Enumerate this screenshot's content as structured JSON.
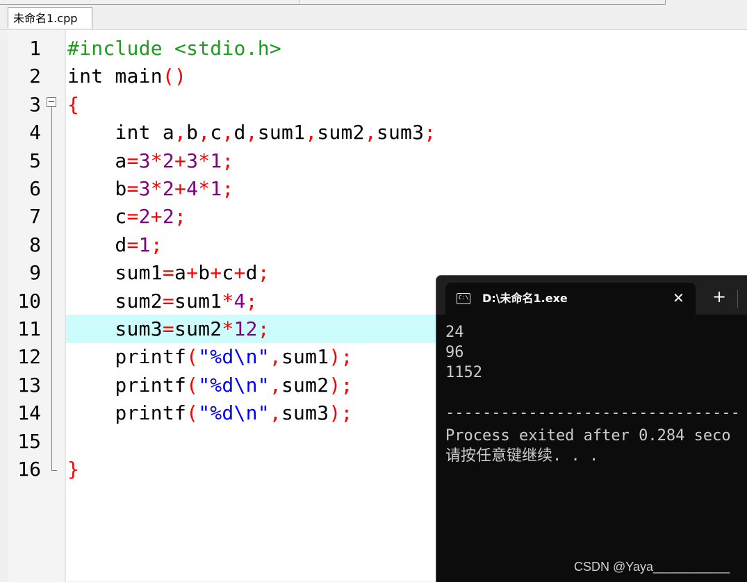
{
  "file_tab": {
    "label": "未命名1.cpp"
  },
  "colors": {
    "preprocessor": "#1f9b1f",
    "operator": "#ff0000",
    "number": "#800080",
    "string": "#0000ff",
    "current_line_highlight": "#ccfcfc",
    "console_background": "#0c0c0c",
    "console_text": "#cccccc"
  },
  "editor": {
    "line_numbers": [
      "1",
      "2",
      "3",
      "4",
      "5",
      "6",
      "7",
      "8",
      "9",
      "10",
      "11",
      "12",
      "13",
      "14",
      "15",
      "16"
    ],
    "highlighted_line": "11",
    "fold_icon": "minus-box-icon",
    "code_lines": [
      [
        {
          "t": "pre",
          "s": "#include <stdio.h>"
        }
      ],
      [
        {
          "t": "kw",
          "s": "int"
        },
        {
          "t": "id",
          "s": " main"
        },
        {
          "t": "op",
          "s": "()"
        }
      ],
      [
        {
          "t": "op",
          "s": "{"
        }
      ],
      [
        {
          "t": "id",
          "s": "    "
        },
        {
          "t": "kw",
          "s": "int"
        },
        {
          "t": "id",
          "s": " a"
        },
        {
          "t": "op",
          "s": ","
        },
        {
          "t": "id",
          "s": "b"
        },
        {
          "t": "op",
          "s": ","
        },
        {
          "t": "id",
          "s": "c"
        },
        {
          "t": "op",
          "s": ","
        },
        {
          "t": "id",
          "s": "d"
        },
        {
          "t": "op",
          "s": ","
        },
        {
          "t": "id",
          "s": "sum1"
        },
        {
          "t": "op",
          "s": ","
        },
        {
          "t": "id",
          "s": "sum2"
        },
        {
          "t": "op",
          "s": ","
        },
        {
          "t": "id",
          "s": "sum3"
        },
        {
          "t": "op",
          "s": ";"
        }
      ],
      [
        {
          "t": "id",
          "s": "    a"
        },
        {
          "t": "op",
          "s": "="
        },
        {
          "t": "num",
          "s": "3"
        },
        {
          "t": "op",
          "s": "*"
        },
        {
          "t": "num",
          "s": "2"
        },
        {
          "t": "op",
          "s": "+"
        },
        {
          "t": "num",
          "s": "3"
        },
        {
          "t": "op",
          "s": "*"
        },
        {
          "t": "num",
          "s": "1"
        },
        {
          "t": "op",
          "s": ";"
        }
      ],
      [
        {
          "t": "id",
          "s": "    b"
        },
        {
          "t": "op",
          "s": "="
        },
        {
          "t": "num",
          "s": "3"
        },
        {
          "t": "op",
          "s": "*"
        },
        {
          "t": "num",
          "s": "2"
        },
        {
          "t": "op",
          "s": "+"
        },
        {
          "t": "num",
          "s": "4"
        },
        {
          "t": "op",
          "s": "*"
        },
        {
          "t": "num",
          "s": "1"
        },
        {
          "t": "op",
          "s": ";"
        }
      ],
      [
        {
          "t": "id",
          "s": "    c"
        },
        {
          "t": "op",
          "s": "="
        },
        {
          "t": "num",
          "s": "2"
        },
        {
          "t": "op",
          "s": "+"
        },
        {
          "t": "num",
          "s": "2"
        },
        {
          "t": "op",
          "s": ";"
        }
      ],
      [
        {
          "t": "id",
          "s": "    d"
        },
        {
          "t": "op",
          "s": "="
        },
        {
          "t": "num",
          "s": "1"
        },
        {
          "t": "op",
          "s": ";"
        }
      ],
      [
        {
          "t": "id",
          "s": "    sum1"
        },
        {
          "t": "op",
          "s": "="
        },
        {
          "t": "id",
          "s": "a"
        },
        {
          "t": "op",
          "s": "+"
        },
        {
          "t": "id",
          "s": "b"
        },
        {
          "t": "op",
          "s": "+"
        },
        {
          "t": "id",
          "s": "c"
        },
        {
          "t": "op",
          "s": "+"
        },
        {
          "t": "id",
          "s": "d"
        },
        {
          "t": "op",
          "s": ";"
        }
      ],
      [
        {
          "t": "id",
          "s": "    sum2"
        },
        {
          "t": "op",
          "s": "="
        },
        {
          "t": "id",
          "s": "sum1"
        },
        {
          "t": "op",
          "s": "*"
        },
        {
          "t": "num",
          "s": "4"
        },
        {
          "t": "op",
          "s": ";"
        }
      ],
      [
        {
          "t": "id",
          "s": "    sum3"
        },
        {
          "t": "op",
          "s": "="
        },
        {
          "t": "id",
          "s": "sum2"
        },
        {
          "t": "op",
          "s": "*"
        },
        {
          "t": "num",
          "s": "12"
        },
        {
          "t": "op",
          "s": ";"
        }
      ],
      [
        {
          "t": "id",
          "s": "    printf"
        },
        {
          "t": "op",
          "s": "("
        },
        {
          "t": "str",
          "s": "\"%d\\n\""
        },
        {
          "t": "op",
          "s": ","
        },
        {
          "t": "id",
          "s": "sum1"
        },
        {
          "t": "op",
          "s": ");"
        }
      ],
      [
        {
          "t": "id",
          "s": "    printf"
        },
        {
          "t": "op",
          "s": "("
        },
        {
          "t": "str",
          "s": "\"%d\\n\""
        },
        {
          "t": "op",
          "s": ","
        },
        {
          "t": "id",
          "s": "sum2"
        },
        {
          "t": "op",
          "s": ");"
        }
      ],
      [
        {
          "t": "id",
          "s": "    printf"
        },
        {
          "t": "op",
          "s": "("
        },
        {
          "t": "str",
          "s": "\"%d\\n\""
        },
        {
          "t": "op",
          "s": ","
        },
        {
          "t": "id",
          "s": "sum3"
        },
        {
          "t": "op",
          "s": ");"
        }
      ],
      [],
      [
        {
          "t": "op",
          "s": "}"
        }
      ]
    ]
  },
  "console": {
    "tab_icon": "terminal-icon",
    "tab_icon_text": "C:\\",
    "tab_title": "D:\\未命名1.exe",
    "close_icon": "close-icon",
    "close_symbol": "✕",
    "new_tab_icon": "plus-icon",
    "new_tab_symbol": "+",
    "output_lines": [
      "24",
      "96",
      "1152",
      "",
      "--------------------------------",
      "Process exited after 0.284 seco",
      "请按任意键继续. . ."
    ]
  },
  "watermark": {
    "text": "CSDN @Yaya___________"
  }
}
